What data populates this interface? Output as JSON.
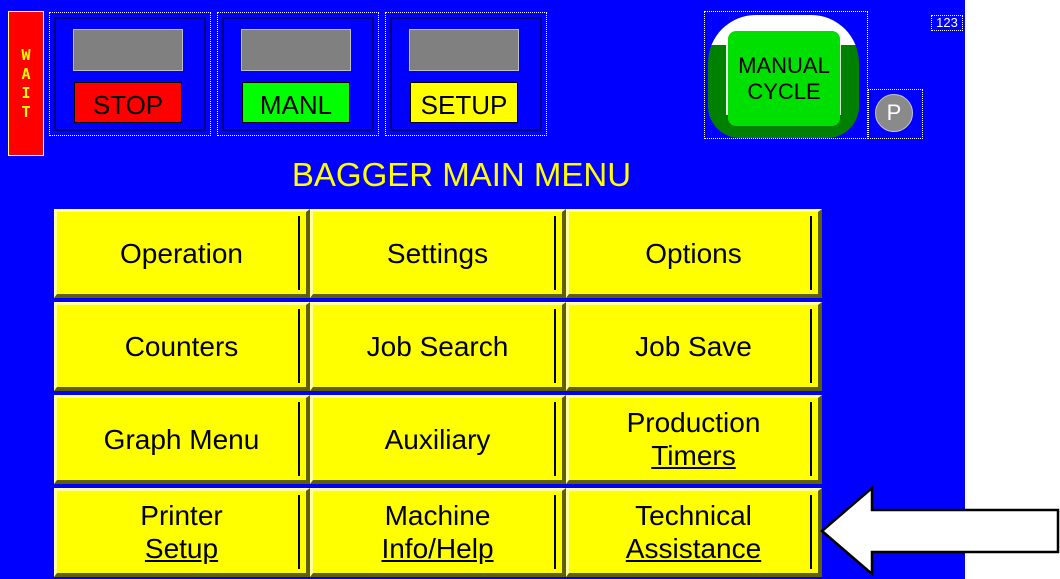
{
  "status": {
    "wait_letters": [
      "W",
      "A",
      "I",
      "T"
    ]
  },
  "mode_buttons": [
    {
      "label": "STOP",
      "color": "#ff0000"
    },
    {
      "label": "MANL",
      "color": "#00ff00"
    },
    {
      "label": "SETUP",
      "color": "#ffff00"
    }
  ],
  "manual_cycle": {
    "line1": "MANUAL",
    "line2": "CYCLE"
  },
  "p_button": {
    "label": "P"
  },
  "keypad_icon": {
    "label": "123"
  },
  "title": "BAGGER MAIN MENU",
  "menu": [
    {
      "line1": "Operation",
      "line2": ""
    },
    {
      "line1": "Settings",
      "line2": ""
    },
    {
      "line1": "Options",
      "line2": ""
    },
    {
      "line1": "Counters",
      "line2": ""
    },
    {
      "line1": "Job Search",
      "line2": ""
    },
    {
      "line1": "Job Save",
      "line2": ""
    },
    {
      "line1": "Graph Menu",
      "line2": ""
    },
    {
      "line1": "Auxiliary",
      "line2": ""
    },
    {
      "line1": "Production",
      "line2": "Timers"
    },
    {
      "line1": "Printer",
      "line2": "Setup"
    },
    {
      "line1": "Machine",
      "line2": "Info/Help"
    },
    {
      "line1": "Technical",
      "line2": "Assistance"
    }
  ],
  "colors": {
    "background": "#0000ff",
    "button": "#ffff00",
    "title": "#ffff00"
  },
  "icons": {
    "arrow": "left-arrow-icon"
  }
}
